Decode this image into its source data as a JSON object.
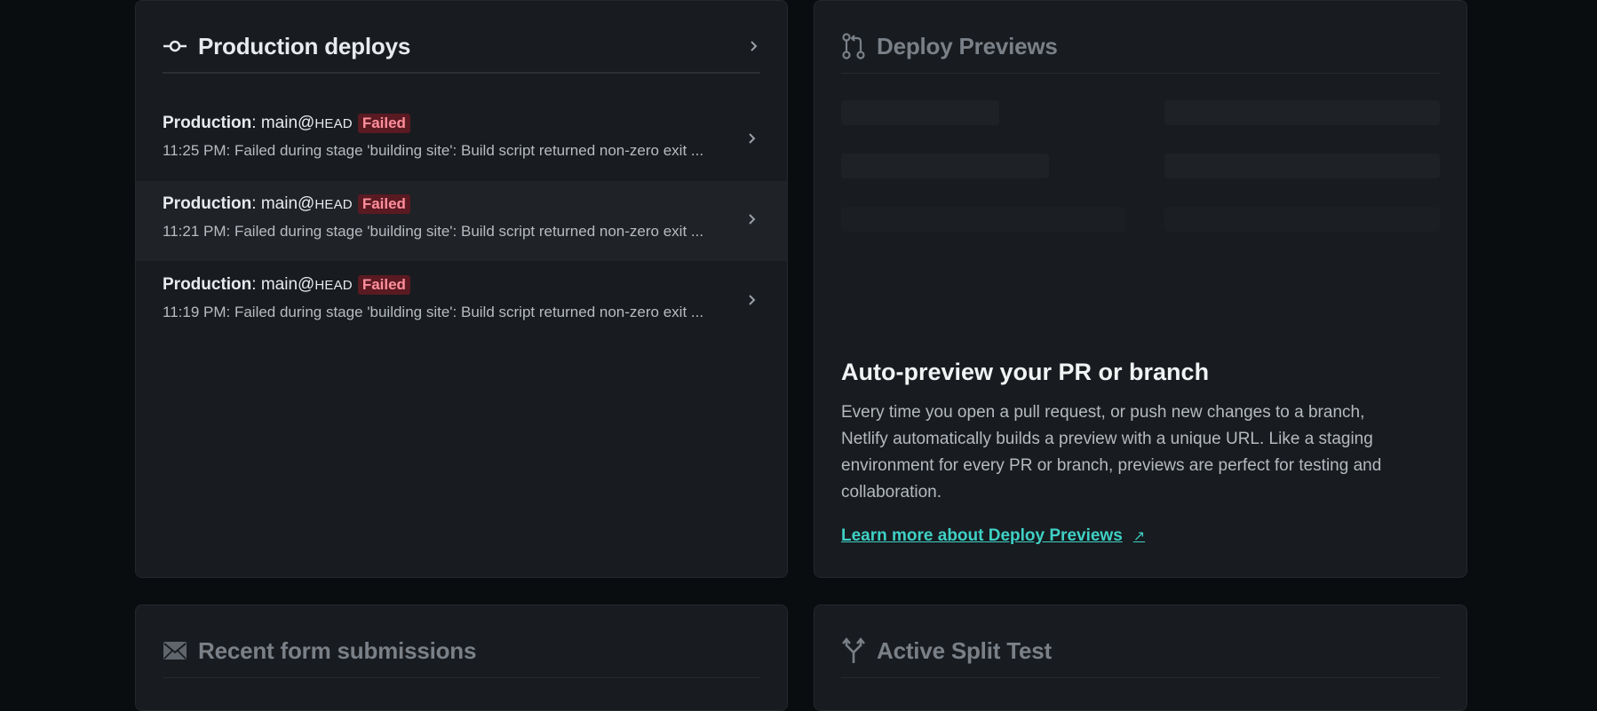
{
  "production_deploys": {
    "title": "Production deploys",
    "rows": [
      {
        "label": "Production",
        "branch": "main@",
        "ref": "HEAD",
        "status": "Failed",
        "message": "11:25 PM: Failed during stage 'building site': Build script returned non-zero exit ..."
      },
      {
        "label": "Production",
        "branch": "main@",
        "ref": "HEAD",
        "status": "Failed",
        "message": "11:21 PM: Failed during stage 'building site': Build script returned non-zero exit ..."
      },
      {
        "label": "Production",
        "branch": "main@",
        "ref": "HEAD",
        "status": "Failed",
        "message": "11:19 PM: Failed during stage 'building site': Build script returned non-zero exit ..."
      }
    ]
  },
  "deploy_previews": {
    "title": "Deploy Previews",
    "heading": "Auto-preview your PR or branch",
    "description": "Every time you open a pull request, or push new changes to a branch, Netlify automatically builds a preview with a unique URL. Like a staging environment for every PR or branch, previews are perfect for testing and collaboration.",
    "link_text": "Learn more about Deploy Previews",
    "link_icon": "external-arrow-icon"
  },
  "recent_forms": {
    "title": "Recent form submissions"
  },
  "split_test": {
    "title": "Active Split Test"
  },
  "colors": {
    "page_bg": "#0a0d10",
    "card_bg": "#181b1f",
    "failed_badge_bg": "#5a1a22",
    "failed_badge_text": "#ff8f9b",
    "link": "#3fd1c6"
  }
}
